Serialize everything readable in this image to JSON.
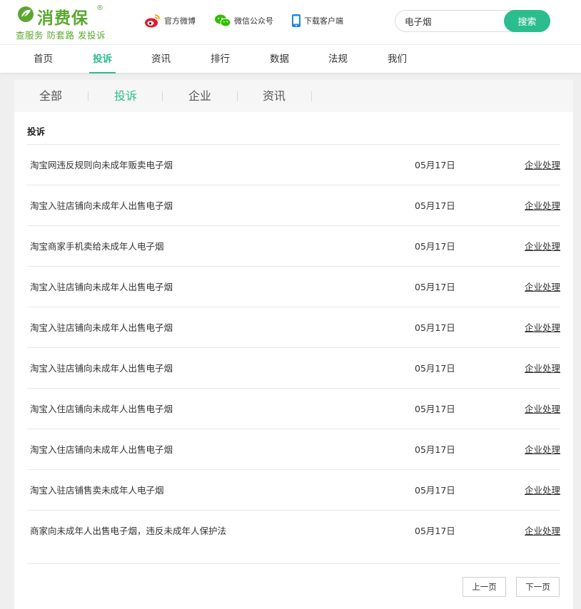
{
  "brand": {
    "title": "消费保",
    "registered": "®",
    "slogan": "查服务 防套路 发投诉",
    "color": "#5aa82f"
  },
  "header_links": [
    {
      "label": "官方微博",
      "icon": "weibo-icon"
    },
    {
      "label": "微信公众号",
      "icon": "wechat-icon"
    },
    {
      "label": "下载客户端",
      "icon": "mobile-phone-icon"
    }
  ],
  "search": {
    "value": "电子烟",
    "button_label": "搜索"
  },
  "nav": {
    "items": [
      {
        "label": "首页",
        "active": false
      },
      {
        "label": "投诉",
        "active": true
      },
      {
        "label": "资讯",
        "active": false
      },
      {
        "label": "排行",
        "active": false
      },
      {
        "label": "数据",
        "active": false
      },
      {
        "label": "法规",
        "active": false
      },
      {
        "label": "我们",
        "active": false
      }
    ]
  },
  "tabs": {
    "items": [
      {
        "label": "全部",
        "active": false
      },
      {
        "label": "投诉",
        "active": true
      },
      {
        "label": "企业",
        "active": false
      },
      {
        "label": "资讯",
        "active": false
      }
    ]
  },
  "section": {
    "title": "投诉"
  },
  "complaints": [
    {
      "title": "淘宝网违反规则向未成年贩卖电子烟",
      "date": "05月17日",
      "status": "企业处理"
    },
    {
      "title": "淘宝入驻店铺向未成年人出售电子烟",
      "date": "05月17日",
      "status": "企业处理"
    },
    {
      "title": "淘宝商家手机卖给未成年人电子烟",
      "date": "05月17日",
      "status": "企业处理"
    },
    {
      "title": "淘宝入驻店铺向未成年人出售电子烟",
      "date": "05月17日",
      "status": "企业处理"
    },
    {
      "title": "淘宝入驻店铺向未成年人出售电子烟",
      "date": "05月17日",
      "status": "企业处理"
    },
    {
      "title": "淘宝入驻店铺向未成年人出售电子烟",
      "date": "05月17日",
      "status": "企业处理"
    },
    {
      "title": "淘宝入住店铺向未成年人出售电子烟",
      "date": "05月17日",
      "status": "企业处理"
    },
    {
      "title": "淘宝入住店铺向未成年人出售电子烟",
      "date": "05月17日",
      "status": "企业处理"
    },
    {
      "title": "淘宝入驻店铺售卖未成年人电子烟",
      "date": "05月17日",
      "status": "企业处理"
    },
    {
      "title": "商家向未成年人出售电子烟，违反未成年人保护法",
      "date": "05月17日",
      "status": "企业处理"
    }
  ],
  "pager": {
    "prev_label": "上一页",
    "next_label": "下一页"
  },
  "colors": {
    "accent": "#2bbd8d",
    "brand_green": "#5aa82f",
    "page_background": "#efefef"
  }
}
